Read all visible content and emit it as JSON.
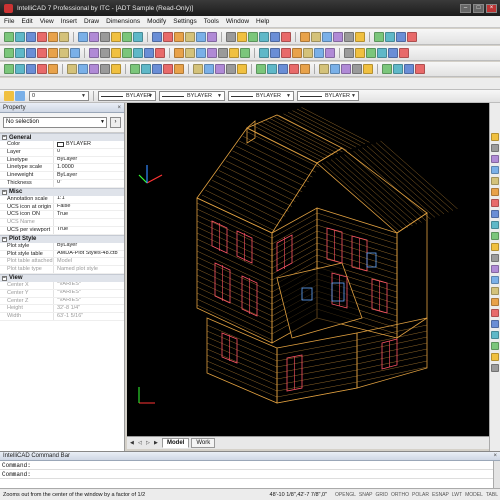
{
  "window": {
    "title": "IntelliCAD 7 Professional by ITC - [ADT Sample (Read-Only)]"
  },
  "menu": [
    "File",
    "Edit",
    "View",
    "Insert",
    "Draw",
    "Dimensions",
    "Modify",
    "Settings",
    "Tools",
    "Window",
    "Help"
  ],
  "layers_bar": {
    "layer_value": "0",
    "color_value": "BYLAYER",
    "linetype_value": "BYLAYER",
    "lineweight_value": "BYLAYER",
    "plotstyle_value": "BYLAYER"
  },
  "properties_panel": {
    "title": "Property",
    "selection": "No selection",
    "sections": [
      {
        "name": "General",
        "rows": [
          {
            "key": "Color",
            "value": "BYLAYER",
            "swatch": true
          },
          {
            "key": "Layer",
            "value": "0"
          },
          {
            "key": "Linetype",
            "value": "ByLayer"
          },
          {
            "key": "Linetype scale",
            "value": "1.0000"
          },
          {
            "key": "Lineweight",
            "value": "ByLayer"
          },
          {
            "key": "Thickness",
            "value": "0\""
          }
        ]
      },
      {
        "name": "Misc",
        "rows": [
          {
            "key": "Annotation scale",
            "value": "1:1"
          },
          {
            "key": "UCS icon at origin",
            "value": "False"
          },
          {
            "key": "UCS icon ON",
            "value": "True"
          },
          {
            "key": "UCS Name",
            "value": "",
            "dim": true
          },
          {
            "key": "UCS per viewport",
            "value": "True"
          }
        ]
      },
      {
        "name": "Plot Style",
        "rows": [
          {
            "key": "Plot style",
            "value": "ByLayer"
          },
          {
            "key": "Plot style table",
            "value": "AMDA-Plot Styles-48.ctb"
          },
          {
            "key": "Plot table attached to",
            "value": "Model",
            "dim": true
          },
          {
            "key": "Plot table type",
            "value": "Named plot style",
            "dim": true
          }
        ]
      },
      {
        "name": "View",
        "rows": [
          {
            "key": "Center X",
            "value": "*VARIES*",
            "dim": true
          },
          {
            "key": "Center Y",
            "value": "*VARIES*",
            "dim": true
          },
          {
            "key": "Center Z",
            "value": "*VARIES*",
            "dim": true
          },
          {
            "key": "Height",
            "value": "32'-8 1/4\"",
            "dim": true
          },
          {
            "key": "Width",
            "value": "63'-1 5/16\"",
            "dim": true
          }
        ]
      }
    ]
  },
  "layout_tabs": [
    "Model",
    "Work"
  ],
  "command_bar": {
    "title": "IntelliCAD Command Bar",
    "lines": [
      "Command:",
      "Command:"
    ]
  },
  "status": {
    "message": "Zooms out from the center of the window by a factor of 1/2",
    "coords": "48'-10 1/8\",42'-7 7/8\",0\"",
    "toggles": [
      "OPENGL",
      "SNAP",
      "GRID",
      "ORTHO",
      "POLAR",
      "ESNAP",
      "LWT",
      "MODEL",
      "TABL"
    ]
  },
  "colors": {
    "canvas_bg": "#000000",
    "model_lines": "#e0a040",
    "window_frames": "#ff5566",
    "interior_blue": "#66a8ff"
  }
}
